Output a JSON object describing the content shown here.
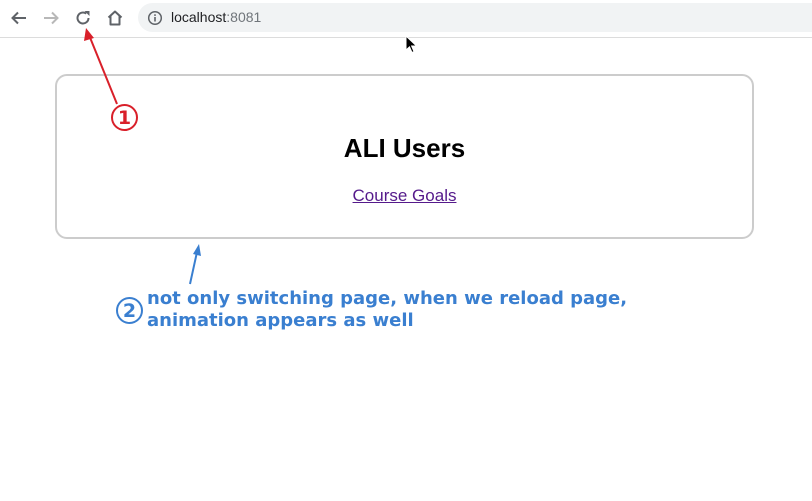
{
  "browser": {
    "url_host": "localhost",
    "url_port": ":8081",
    "icons": {
      "back": "back-arrow-icon",
      "forward": "forward-arrow-icon",
      "reload": "reload-icon",
      "home": "home-icon",
      "info": "info-icon",
      "cursor": "mouse-cursor-icon"
    }
  },
  "page": {
    "title": "ALI Users",
    "link_label": "Course Goals"
  },
  "annotations": {
    "marker1": "1",
    "marker2": "2",
    "note_line1": "not only switching page, when we reload page,",
    "note_line2": "animation appears as well",
    "colors": {
      "red": "#d9202a",
      "blue": "#3a7fd0"
    }
  }
}
